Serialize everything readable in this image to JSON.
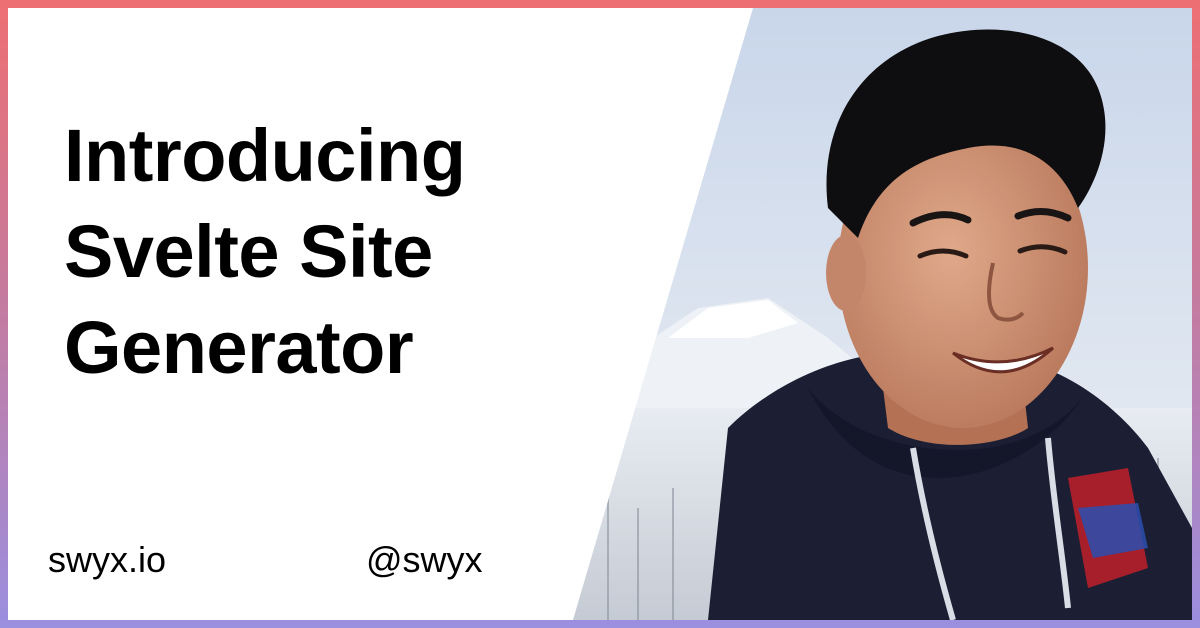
{
  "card": {
    "title": "Introducing Svelte Site Generator",
    "website": "swyx.io",
    "handle": "@swyx"
  },
  "colors": {
    "border_top": "#ee6f73",
    "border_bottom": "#9b8fe0",
    "background": "#ffffff",
    "text": "#000000"
  },
  "photo": {
    "subject": "smiling man in dark hoodie with snowy mountain behind"
  }
}
